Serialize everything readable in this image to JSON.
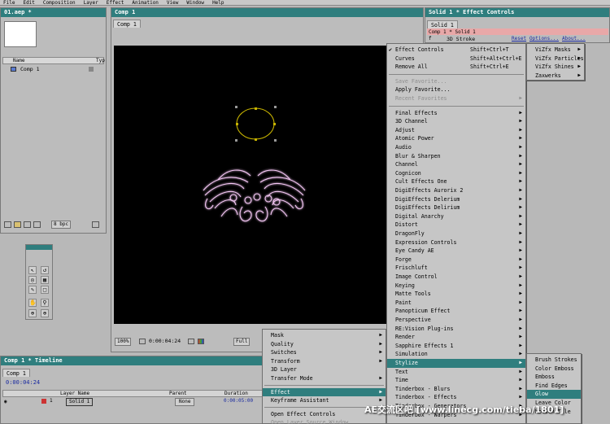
{
  "menubar": [
    "File",
    "Edit",
    "Composition",
    "Layer",
    "Effect",
    "Animation",
    "View",
    "Window",
    "Help"
  ],
  "project": {
    "title": "01.aep *",
    "col_name": "Name",
    "col_type": "Typ",
    "item": "Comp 1",
    "bpc": "8 bpc"
  },
  "comp": {
    "title": "Comp 1",
    "tab": "Comp 1",
    "zoom": "100%",
    "timecode": "0:00:04:24",
    "resolution": "Full"
  },
  "effect_controls": {
    "title": "Solid 1 * Effect Controls",
    "tab": "Solid 1",
    "breadcrumb": "Comp 1 * Solid 1",
    "effect_name": "3D Stroke",
    "reset": "Reset",
    "options": "Options...",
    "about": "About..."
  },
  "timeline": {
    "title": "Comp 1 * Timeline",
    "tab": "Comp 1",
    "timecode": "0:00:04:24",
    "col_layer": "Layer Name",
    "col_parent": "Parent",
    "col_duration": "Duration",
    "layer_index": "1",
    "layer_name": "Solid 1",
    "parent_value": "None",
    "duration_value": "0:00:05:00"
  },
  "context_menu": [
    {
      "label": "Mask",
      "arrow": true
    },
    {
      "label": "Quality",
      "arrow": true
    },
    {
      "label": "Switches",
      "arrow": true
    },
    {
      "label": "Transform",
      "arrow": true
    },
    {
      "label": "3D Layer",
      "arrow": false
    },
    {
      "label": "Transfer Mode",
      "arrow": true
    },
    {
      "label": "Effect",
      "arrow": true,
      "highlight": true
    },
    {
      "label": "Keyframe Assistant",
      "arrow": true
    },
    {
      "label": "Open Effect Controls",
      "arrow": false
    },
    {
      "label": "Open Layer Source Window",
      "arrow": false,
      "disabled": true
    }
  ],
  "effect_menu_top": [
    {
      "label": "Effect Controls",
      "shortcut": "Shift+Ctrl+T",
      "check": true
    },
    {
      "label": "Curves",
      "shortcut": "Shift+Alt+Ctrl+E"
    },
    {
      "label": "Remove All",
      "shortcut": "Shift+Ctrl+E"
    },
    {
      "label": "Save Favorite...",
      "disabled": true
    },
    {
      "label": "Apply Favorite..."
    },
    {
      "label": "Recent Favorites",
      "disabled": true,
      "arrow": true
    }
  ],
  "effect_categories": [
    "Final Effects",
    "3D Channel",
    "Adjust",
    "Atomic Power",
    "Audio",
    "Blur & Sharpen",
    "Channel",
    "Cognicon",
    "Cult Effects One",
    "DigiEffects Aurorix 2",
    "DigiEffects Delerium",
    "DigiEffects Delirium",
    "Digital Anarchy",
    "Distort",
    "DragonFly",
    "Expression Controls",
    "Eye Candy AE",
    "Forge",
    "Frischluft",
    "Image Control",
    "Keying",
    "Matte Tools",
    "Paint",
    "Panopticum Effect",
    "Perspective",
    "RE:Vision Plug-ins",
    "Render",
    "Sapphire Effects 1",
    "Simulation",
    "Stylize",
    "Text",
    "Time",
    "Tinderbox - Blurs",
    "Tinderbox - Effects",
    "Tinderbox - Generators",
    "Tinderbox - Warpers"
  ],
  "effect_highlight": "Stylize",
  "vizfx_menu": [
    "ViZfx Masks",
    "ViZfx Particles",
    "ViZfx Shines",
    "Zaxwerks"
  ],
  "stylize_menu": [
    "Brush Strokes",
    "Color Emboss",
    "Emboss",
    "Find Edges",
    "Glow",
    "Leave Color",
    "Motion Tile"
  ],
  "stylize_highlight": "Glow",
  "watermark": "AE交流区吧 [www.linecg.com/tieba/1801]",
  "colors": {
    "title_teal": "#2f7e7e",
    "highlight": "#2f7e7e",
    "timecode_blue": "#1a2aa0",
    "mask_yellow": "#c8b400",
    "glow_pink": "#f0b0f0"
  }
}
